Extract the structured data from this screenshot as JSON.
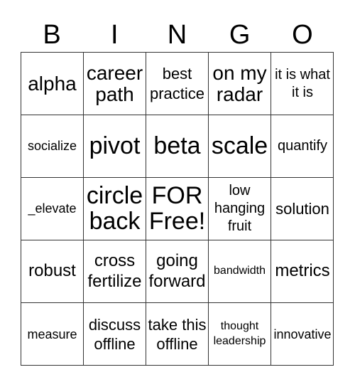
{
  "header": {
    "letters": [
      "B",
      "I",
      "N",
      "G",
      "O"
    ]
  },
  "grid": {
    "cells": [
      {
        "text": "alpha",
        "size": "s-l"
      },
      {
        "text": "career path",
        "size": "s-l"
      },
      {
        "text": "best practice",
        "size": "s-m"
      },
      {
        "text": "on my radar",
        "size": "s-l"
      },
      {
        "text": "it is what it is",
        "size": "s-s"
      },
      {
        "text": "socialize",
        "size": "s-xs"
      },
      {
        "text": "pivot",
        "size": "s-xl"
      },
      {
        "text": "beta",
        "size": "s-xl"
      },
      {
        "text": "scale",
        "size": "s-xl"
      },
      {
        "text": "quantify",
        "size": "s-s"
      },
      {
        "text": "_elevate",
        "size": "s-xs"
      },
      {
        "text": "circle back",
        "size": "s-xl"
      },
      {
        "text": "FOR Free!",
        "size": "s-xl"
      },
      {
        "text": "low hanging fruit",
        "size": "s-s"
      },
      {
        "text": "solution",
        "size": "s-m"
      },
      {
        "text": "robust",
        "size": "s-ml"
      },
      {
        "text": "cross fertilize",
        "size": "s-ml"
      },
      {
        "text": "going forward",
        "size": "s-ml"
      },
      {
        "text": "bandwidth",
        "size": "s-xxs"
      },
      {
        "text": "metrics",
        "size": "s-ml"
      },
      {
        "text": "measure",
        "size": "s-xs"
      },
      {
        "text": "discuss offline",
        "size": "s-m"
      },
      {
        "text": "take this offline",
        "size": "s-m"
      },
      {
        "text": "thought leadership",
        "size": "s-xxs"
      },
      {
        "text": "innovative",
        "size": "s-xs"
      }
    ]
  }
}
